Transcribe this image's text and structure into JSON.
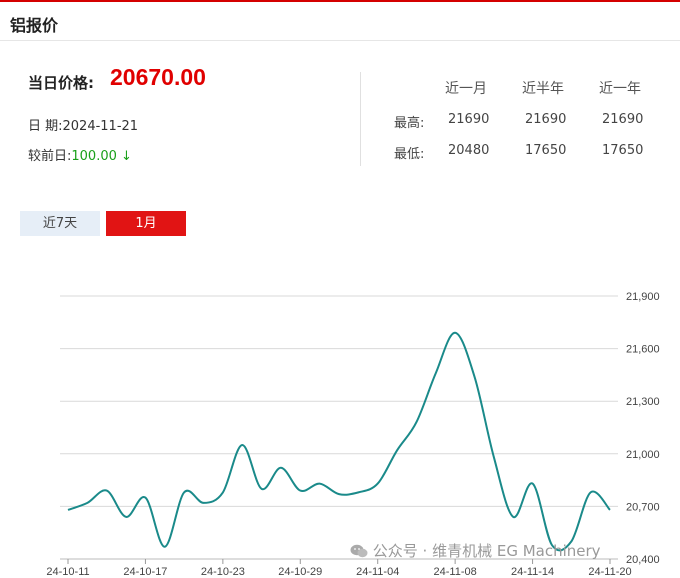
{
  "header": {
    "title": "铝报价"
  },
  "price": {
    "label": "当日价格:",
    "value": "20670.00"
  },
  "date": {
    "text": "日 期:2024-11-21"
  },
  "change": {
    "label": "较前日:",
    "value": "100.00",
    "arrow": "↓"
  },
  "stats": {
    "headers": [
      "近一月",
      "近半年",
      "近一年"
    ],
    "rows": [
      {
        "label": "最高:",
        "values": [
          "21690",
          "21690",
          "21690"
        ]
      },
      {
        "label": "最低:",
        "values": [
          "20480",
          "17650",
          "17650"
        ]
      }
    ]
  },
  "tabs": [
    {
      "label": "近7天",
      "active": false
    },
    {
      "label": "1月",
      "active": true
    }
  ],
  "watermark": {
    "text": "公众号 · 维青机械 EG Machinery"
  },
  "colors": {
    "accent": "#e11414",
    "line": "#1a8a8a",
    "change_down": "#1aa01a"
  },
  "chart_data": {
    "type": "line",
    "x_tick_labels": [
      "24-10-11",
      "24-10-17",
      "24-10-23",
      "24-10-29",
      "24-11-04",
      "24-11-08",
      "24-11-14",
      "24-11-20"
    ],
    "y_tick_labels": [
      "21,900",
      "21,600",
      "21,300",
      "21,000",
      "20,700",
      "20,400"
    ],
    "ylim": [
      20400,
      21900
    ],
    "grid": true,
    "values": [
      20680,
      20720,
      20790,
      20640,
      20750,
      20470,
      20780,
      20720,
      20780,
      21050,
      20800,
      20920,
      20790,
      20830,
      20770,
      20780,
      20830,
      21020,
      21180,
      21460,
      21690,
      21440,
      20980,
      20640,
      20830,
      20480,
      20500,
      20780,
      20680
    ]
  }
}
